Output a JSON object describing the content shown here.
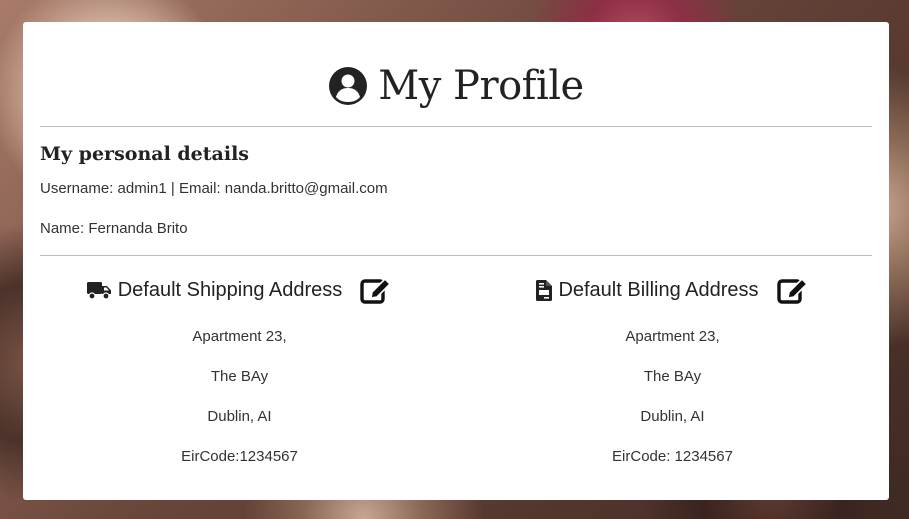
{
  "profile": {
    "title": "My Profile",
    "title_icon": "user-circle-icon"
  },
  "personal": {
    "heading": "My personal details",
    "account_line": "Username: admin1 | Email: nanda.britto@gmail.com",
    "name_line": "Name: Fernanda Brito"
  },
  "shipping": {
    "heading": "Default Shipping Address",
    "icon": "truck-icon",
    "edit_icon": "edit-icon",
    "lines": [
      "Apartment 23,",
      "The BAy",
      "Dublin, AI",
      "EirCode:1234567"
    ]
  },
  "billing": {
    "heading": "Default Billing Address",
    "icon": "invoice-icon",
    "edit_icon": "edit-icon",
    "lines": [
      "Apartment 23,",
      "The BAy",
      "Dublin, AI",
      "EirCode: 1234567"
    ]
  },
  "colors": {
    "text": "#222222",
    "rule": "#bdbdbd",
    "card": "#ffffff"
  }
}
